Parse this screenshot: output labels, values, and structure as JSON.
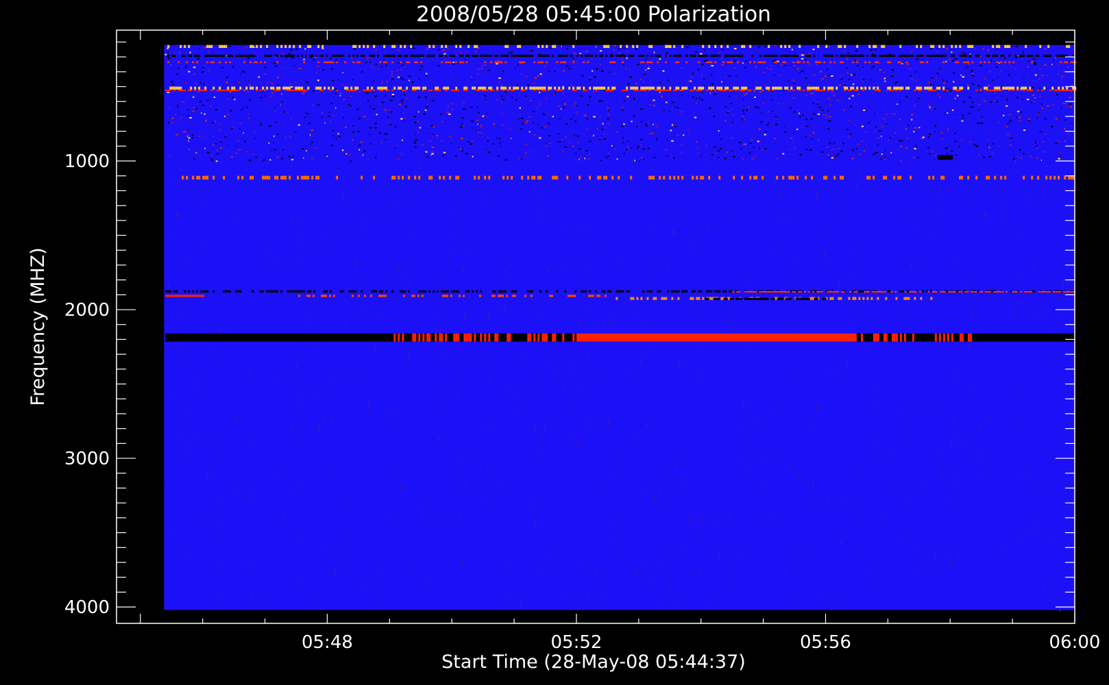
{
  "chart_data": {
    "type": "heatmap",
    "title": "2008/05/28 05:45:00 Polarization",
    "xlabel": "Start Time (28-May-08 05:44:37)",
    "ylabel": "Frequency (MHZ)",
    "x_tick_labels": [
      "05:48",
      "05:52",
      "05:56",
      "06:00"
    ],
    "x_ticks_minutes": [
      48,
      52,
      56,
      60
    ],
    "x_range_minutes_after_0500": [
      44.617,
      60
    ],
    "x_data_range_minutes_after_0500": [
      45.38,
      60
    ],
    "y_tick_labels": [
      "1000",
      "2000",
      "3000",
      "4000"
    ],
    "y_ticks": [
      1000,
      2000,
      3000,
      4000
    ],
    "y_range": [
      120,
      4110
    ],
    "y_data_range": [
      220,
      4020
    ],
    "y_reversed": true,
    "colors": {
      "background": "#000000",
      "field": "#1c10f6",
      "burst": "#ff2200",
      "hot": "#ffcc44"
    },
    "bands": [
      {
        "f0": 220,
        "f1": 240,
        "t0": 45.4,
        "t1": 60,
        "color": "#ffcc44",
        "density": 0.25
      },
      {
        "f0": 285,
        "f1": 300,
        "t0": 45.4,
        "t1": 60,
        "color": "#000000",
        "density": 0.7
      },
      {
        "f0": 330,
        "f1": 342,
        "t0": 45.4,
        "t1": 60,
        "color": "#ff3300",
        "density": 0.35
      },
      {
        "f0": 500,
        "f1": 520,
        "t0": 45.4,
        "t1": 60,
        "color": "#ffcc44",
        "density": 0.5
      },
      {
        "f0": 520,
        "f1": 530,
        "t0": 45.4,
        "t1": 60,
        "color": "#ff2200",
        "density": 0.5
      },
      {
        "f0": 1100,
        "f1": 1125,
        "t0": 45.4,
        "t1": 60,
        "color": "#ff6a00",
        "density": 0.3
      },
      {
        "f0": 1870,
        "f1": 1885,
        "t0": 45.4,
        "t1": 60,
        "color": "#000000",
        "density": 0.5
      },
      {
        "f0": 1875,
        "f1": 1885,
        "t0": 54.5,
        "t1": 60,
        "color": "#ff3300",
        "density": 0.7
      },
      {
        "f0": 1900,
        "f1": 1915,
        "t0": 45.4,
        "t1": 46.0,
        "color": "#ff2200",
        "density": 0.9
      },
      {
        "f0": 1900,
        "f1": 1915,
        "t0": 47.5,
        "t1": 52.5,
        "color": "#ff4400",
        "density": 0.35
      },
      {
        "f0": 1915,
        "f1": 1935,
        "t0": 52.5,
        "t1": 57.8,
        "color": "#ff8800",
        "density": 0.4
      },
      {
        "f0": 1920,
        "f1": 1935,
        "t0": 54.0,
        "t1": 56.0,
        "color": "#000000",
        "density": 0.7
      },
      {
        "f0": 2160,
        "f1": 2215,
        "t0": 45.4,
        "t1": 60,
        "color": "#000000",
        "density": 1.0
      },
      {
        "f0": 2160,
        "f1": 2215,
        "t0": 49.0,
        "t1": 52.0,
        "color": "#ff2200",
        "density": 0.35
      },
      {
        "f0": 2160,
        "f1": 2215,
        "t0": 52.0,
        "t1": 56.5,
        "color": "#ff2200",
        "density": 0.95
      },
      {
        "f0": 2160,
        "f1": 2215,
        "t0": 56.5,
        "t1": 58.5,
        "color": "#ff2200",
        "density": 0.3
      }
    ]
  }
}
